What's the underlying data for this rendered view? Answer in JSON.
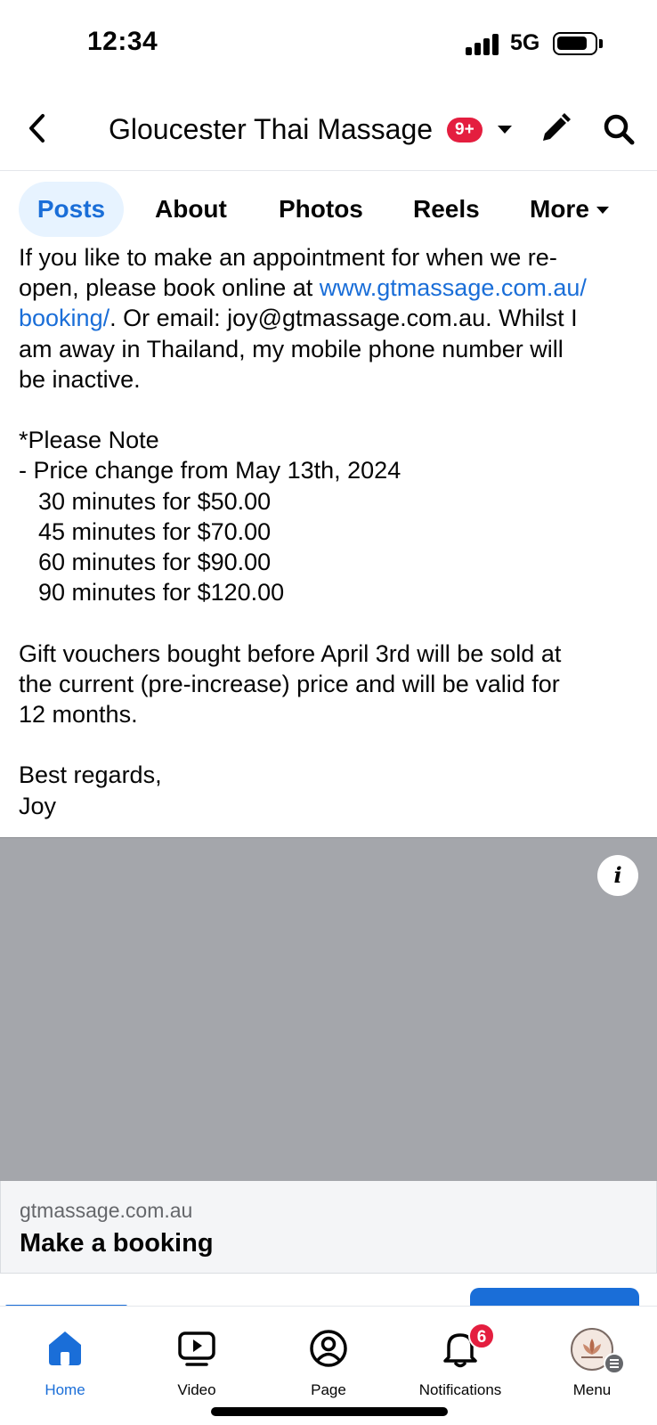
{
  "status_bar": {
    "time": "12:34",
    "network": "5G",
    "icons": [
      "signal-icon",
      "battery-icon"
    ]
  },
  "header": {
    "title": "Gloucester Thai Massage",
    "notification_badge": "9+",
    "icons": [
      "back-arrow-icon",
      "chevron-down-icon",
      "pencil-icon",
      "search-icon"
    ]
  },
  "tabs": [
    {
      "label": "Posts",
      "active": true
    },
    {
      "label": "About",
      "active": false
    },
    {
      "label": "Photos",
      "active": false
    },
    {
      "label": "Reels",
      "active": false
    },
    {
      "label": "More",
      "active": false
    }
  ],
  "post": {
    "para1_before_link": "If you like to make an appointment for when we re-\nopen, please book online at ",
    "para1_link": "www.gtmassage.com.au/\nbooking/",
    "para1_after_link": ". Or email: joy@gtmassage.com.au. Whilst I\nam away in Thailand, my mobile phone number will\nbe inactive.",
    "note_heading": "*Please Note",
    "price_change": "- Price change from May 13th, 2024",
    "prices": [
      "30 minutes for $50.00",
      "45 minutes for $70.00",
      "60 minutes for $90.00",
      "90 minutes for $120.00"
    ],
    "vouchers": "Gift vouchers bought before April 3rd will be sold at\nthe current (pre-increase) price and will be valid for\n12 months.",
    "regards": "Best regards,",
    "signature": "Joy"
  },
  "link_preview": {
    "info_label": "i",
    "domain": "gtmassage.com.au",
    "title": "Make a booking",
    "image_color": "#a4a6ab"
  },
  "bottom_nav": [
    {
      "label": "Home",
      "icon": "home-icon",
      "active": true
    },
    {
      "label": "Video",
      "icon": "video-icon",
      "active": false
    },
    {
      "label": "Page",
      "icon": "page-profile-icon",
      "active": false
    },
    {
      "label": "Notifications",
      "icon": "bell-icon",
      "active": false,
      "badge": "6"
    },
    {
      "label": "Menu",
      "icon": "menu-avatar-icon",
      "active": false
    }
  ],
  "colors": {
    "accent": "#1a6ed8",
    "badge": "#e41e3f",
    "tab_active_bg": "#e7f3ff",
    "text": "#050505",
    "secondary_text": "#65676b"
  }
}
